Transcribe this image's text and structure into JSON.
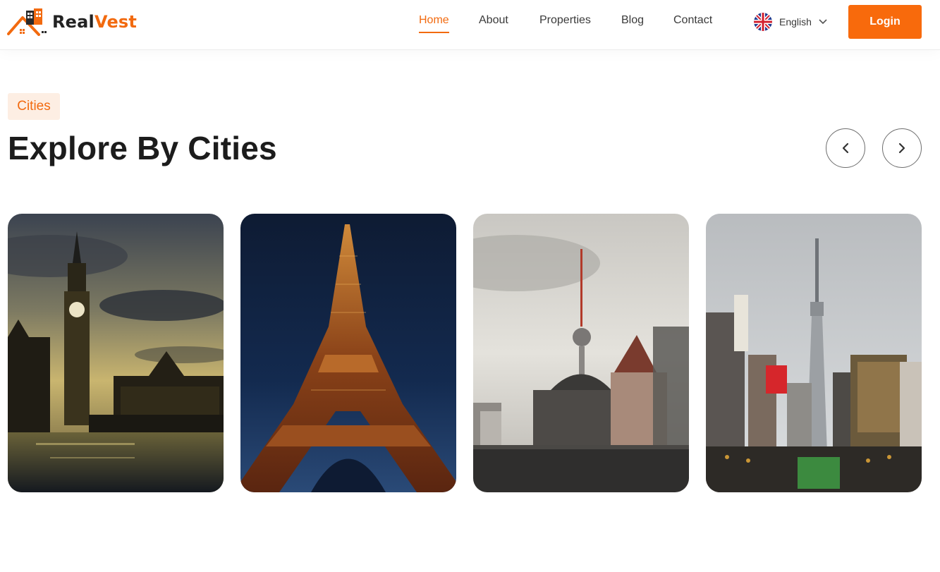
{
  "brand": {
    "name_part1": "Real",
    "name_part2": "Vest",
    "accent_color": "#f86a0c"
  },
  "nav": {
    "items": [
      {
        "label": "Home",
        "active": true
      },
      {
        "label": "About",
        "active": false
      },
      {
        "label": "Properties",
        "active": false
      },
      {
        "label": "Blog",
        "active": false
      },
      {
        "label": "Contact",
        "active": false
      }
    ]
  },
  "language": {
    "selected": "English",
    "flag_icon": "uk-flag-icon"
  },
  "header": {
    "login_label": "Login"
  },
  "section": {
    "badge": "Cities",
    "title": "Explore By Cities",
    "prev_icon": "chevron-left-icon",
    "next_icon": "chevron-right-icon"
  },
  "cities": [
    {
      "image": "big-ben-photo"
    },
    {
      "image": "eiffel-tower-photo"
    },
    {
      "image": "berlin-tv-tower-photo"
    },
    {
      "image": "tokyo-skytree-photo"
    }
  ]
}
